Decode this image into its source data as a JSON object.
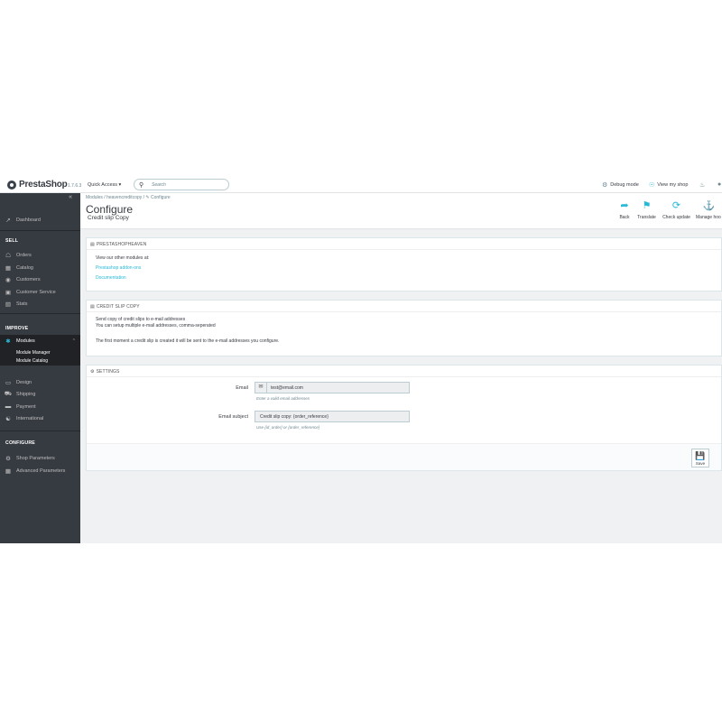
{
  "header": {
    "brand": "PrestaShop",
    "version": "1.7.6.3",
    "quick_access": "Quick Access ▾",
    "search_placeholder": "Search",
    "debug_mode": "Debug mode",
    "view_shop": "View my shop"
  },
  "sidebar": {
    "collapse": "«",
    "dashboard": "Dashboard",
    "section_sell": "SELL",
    "orders": "Orders",
    "catalog": "Catalog",
    "customers": "Customers",
    "customer_service": "Customer Service",
    "stats": "Stats",
    "section_improve": "IMPROVE",
    "modules": "Modules",
    "module_manager": "Module Manager",
    "module_catalog": "Module Catalog",
    "design": "Design",
    "shipping": "Shipping",
    "payment": "Payment",
    "international": "International",
    "section_configure": "CONFIGURE",
    "shop_parameters": "Shop Parameters",
    "advanced_parameters": "Advanced Parameters"
  },
  "page": {
    "breadcrumb": "Modules  /  heavencreditcopy  /  ✎ Configure",
    "title": "Configure",
    "subtitle": "Credit slip Copy"
  },
  "toolbar": {
    "back": "Back",
    "translate": "Translate",
    "check_update": "Check update",
    "manage_hooks": "Manage hoo"
  },
  "panel_heaven": {
    "heading": "PRESTASHOPHEAVEN",
    "intro": "View our other modules at:",
    "link_addons": "Prestashop addon-ons",
    "link_docs": "Documentation"
  },
  "panel_copy": {
    "heading": "CREDIT SLIP COPY",
    "line1": "Send copy of credit slips to e-mail addresses",
    "line2": "You can setup multiple e-mail addresses, comma-seperated",
    "line3": "The first moment a credit slip is created it will be sent to the e-mail addresses you configure."
  },
  "settings": {
    "heading": "SETTINGS",
    "email_label": "Email",
    "email_value": "test@email.com",
    "email_help": "Enter a valid email addresses",
    "subject_label": "Email subject",
    "subject_value": "Credit slip copy: {order_reference}",
    "subject_help": "Use {id_order} or {order_reference}",
    "save": "Save"
  },
  "colors": {
    "sidebar_bg": "#363a41",
    "accent": "#25b9d7",
    "page_bg": "#eff1f2"
  },
  "icons": [
    "logo-icon",
    "search-icon",
    "bug-icon",
    "eye-icon",
    "bell-icon",
    "user-icon",
    "back-icon",
    "flag-icon",
    "refresh-icon",
    "anchor-icon",
    "save-icon"
  ]
}
